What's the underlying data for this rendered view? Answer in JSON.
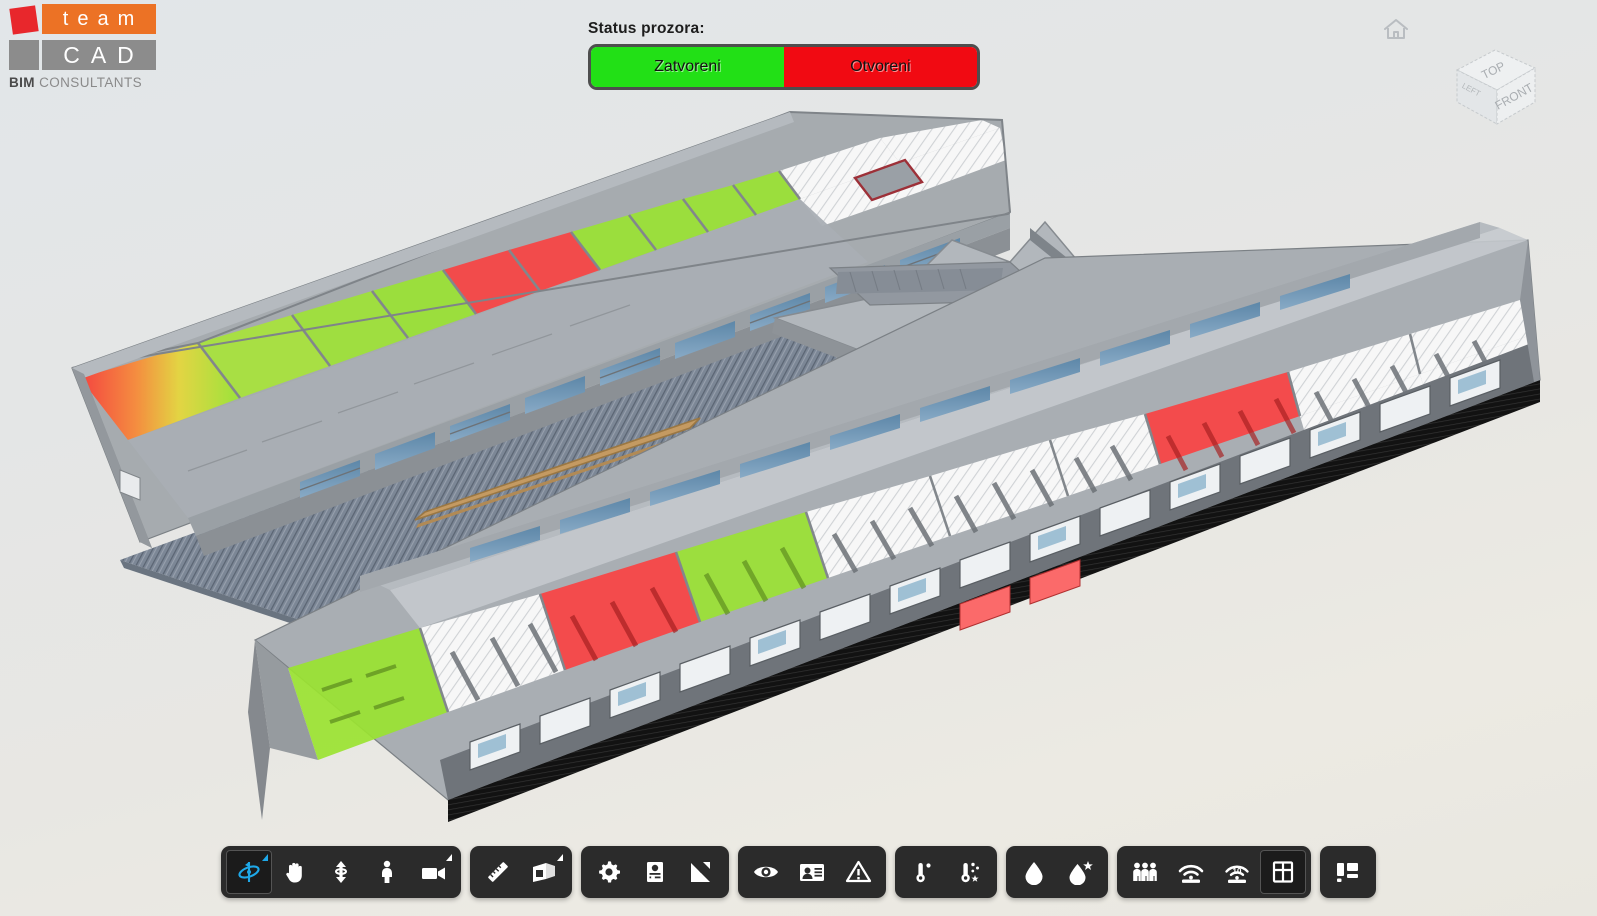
{
  "brand": {
    "word_team": "team",
    "word_cad": "CAD",
    "tagline_bold": "BIM",
    "tagline_rest": " CONSULTANTS",
    "colors": {
      "orange": "#ec7225",
      "gray": "#8c8c8c",
      "red": "#e8272c"
    }
  },
  "status": {
    "title": "Status prozora:",
    "segments": [
      {
        "label": "Zatvoreni",
        "color": "#22e016"
      },
      {
        "label": "Otvoreni",
        "color": "#f10a12"
      }
    ],
    "border_color": "#4e4e4e"
  },
  "nav": {
    "home_label": "Home",
    "viewcube": {
      "top": "TOP",
      "front": "FRONT",
      "left": "LEFT"
    }
  },
  "toolbar": {
    "groups": [
      {
        "name": "navigation",
        "buttons": [
          {
            "icon": "orbit-icon",
            "label": "Orbit",
            "active": true,
            "caret": true
          },
          {
            "icon": "pan-hand-icon",
            "label": "Pan",
            "active": false,
            "caret": false
          },
          {
            "icon": "zoom-updown-icon",
            "label": "Zoom",
            "active": false,
            "caret": false
          },
          {
            "icon": "walk-person-icon",
            "label": "Walk",
            "active": false,
            "caret": false
          },
          {
            "icon": "camera-icon",
            "label": "Camera",
            "active": false,
            "caret": true
          }
        ]
      },
      {
        "name": "measure",
        "buttons": [
          {
            "icon": "ruler-icon",
            "label": "Measure",
            "active": false,
            "caret": false
          },
          {
            "icon": "section-box-icon",
            "label": "Section Box",
            "active": false,
            "caret": true
          }
        ]
      },
      {
        "name": "settings",
        "buttons": [
          {
            "icon": "gear-icon",
            "label": "Settings",
            "active": false,
            "caret": false
          },
          {
            "icon": "sliders-panel-icon",
            "label": "Properties",
            "active": false,
            "caret": false
          },
          {
            "icon": "expand-arrow-icon",
            "label": "Fullscreen",
            "active": false,
            "caret": false
          }
        ]
      },
      {
        "name": "visibility",
        "buttons": [
          {
            "icon": "eye-icon",
            "label": "Visibility",
            "active": false,
            "caret": false
          },
          {
            "icon": "id-card-icon",
            "label": "Info Card",
            "active": false,
            "caret": false
          },
          {
            "icon": "warning-icon",
            "label": "Alarms",
            "active": false,
            "caret": false
          }
        ]
      },
      {
        "name": "temperature",
        "buttons": [
          {
            "icon": "thermometer-sun-icon",
            "label": "Temperature",
            "active": false,
            "caret": false
          },
          {
            "icon": "thermometer-snow-icon",
            "label": "Target Temperature",
            "active": false,
            "caret": false
          }
        ]
      },
      {
        "name": "humidity",
        "buttons": [
          {
            "icon": "droplet-icon",
            "label": "Humidity",
            "active": false,
            "caret": false
          },
          {
            "icon": "droplet-star-icon",
            "label": "Target Humidity",
            "active": false,
            "caret": false
          }
        ]
      },
      {
        "name": "sensors",
        "buttons": [
          {
            "icon": "people-group-icon",
            "label": "Occupancy",
            "active": false,
            "caret": false
          },
          {
            "icon": "wifi-sensor-icon",
            "label": "Sensors",
            "active": false,
            "caret": false
          },
          {
            "icon": "co2-sensor-icon",
            "label": "CO2 Sensor",
            "active": false,
            "caret": false
          },
          {
            "icon": "window-icon",
            "label": "Windows",
            "active": true,
            "caret": false
          }
        ]
      },
      {
        "name": "layout",
        "buttons": [
          {
            "icon": "dashboard-layout-icon",
            "label": "Dashboard",
            "active": false,
            "caret": false
          }
        ]
      }
    ]
  },
  "model": {
    "description": "Isometric BIM building model, two long wings joined by a Y-shaped connector",
    "legend": {
      "closed_window_color": "#8ee832",
      "open_window_color": "#fb4040",
      "neutral_room_color": "#f4f4f4",
      "structure_color": "#9a9ea2"
    }
  }
}
